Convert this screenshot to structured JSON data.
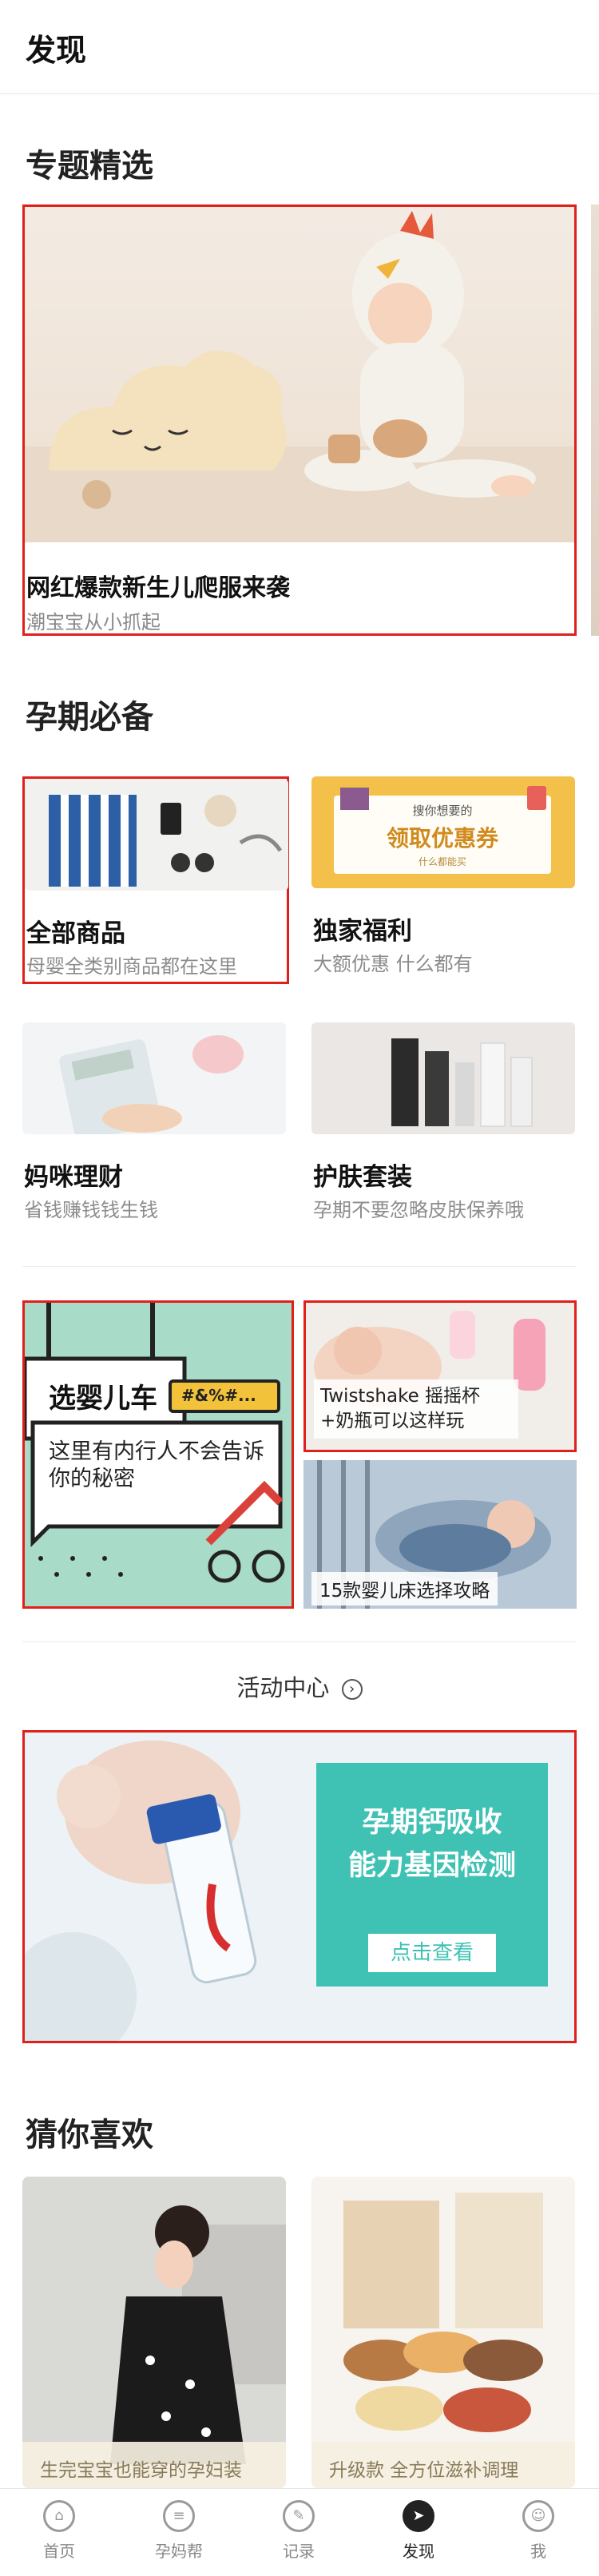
{
  "header": {
    "title": "发现"
  },
  "topics": {
    "title": "专题精选",
    "featured": {
      "name": "网红爆款新生儿爬服来袭",
      "sub": "潮宝宝从小抓起"
    }
  },
  "essentials": {
    "title": "孕期必备",
    "items": [
      {
        "name": "全部商品",
        "sub": "母婴全类别商品都在这里"
      },
      {
        "name": "独家福利",
        "sub": "大额优惠 什么都有",
        "banner_small": "搜你想要的",
        "banner_main": "领取优惠券",
        "banner_tag": "什么都能买"
      },
      {
        "name": "妈咪理财",
        "sub": "省钱赚钱钱生钱"
      },
      {
        "name": "护肤套装",
        "sub": "孕期不要忽略皮肤保养哦"
      }
    ]
  },
  "articles": {
    "stroller": {
      "title": "选婴儿车",
      "bubble": "#&%#...",
      "desc": "这里有内行人不会告诉你的秘密"
    },
    "twistshake": {
      "caption": "Twistshake 摇摇杯+奶瓶可以这样玩"
    },
    "crib": {
      "caption": "15款婴儿床选择攻略"
    }
  },
  "activity": {
    "label": "活动中心",
    "banner": {
      "line1": "孕期钙吸收",
      "line2": "能力基因检测",
      "button": "点击查看"
    }
  },
  "recommend": {
    "title": "猜你喜欢",
    "items": [
      {
        "caption": "生完宝宝也能穿的孕妇装"
      },
      {
        "caption": "升级款 全方位滋补调理"
      }
    ]
  },
  "tabbar": {
    "items": [
      {
        "label": "首页",
        "icon": "home-icon"
      },
      {
        "label": "孕妈帮",
        "icon": "chat-icon"
      },
      {
        "label": "记录",
        "icon": "edit-icon"
      },
      {
        "label": "发现",
        "icon": "compass-icon"
      },
      {
        "label": "我",
        "icon": "face-icon"
      }
    ],
    "active": "发现"
  },
  "colors": {
    "highlight": "#e0201a",
    "teal": "#3fc2b4",
    "coupon": "#f3c04a"
  }
}
